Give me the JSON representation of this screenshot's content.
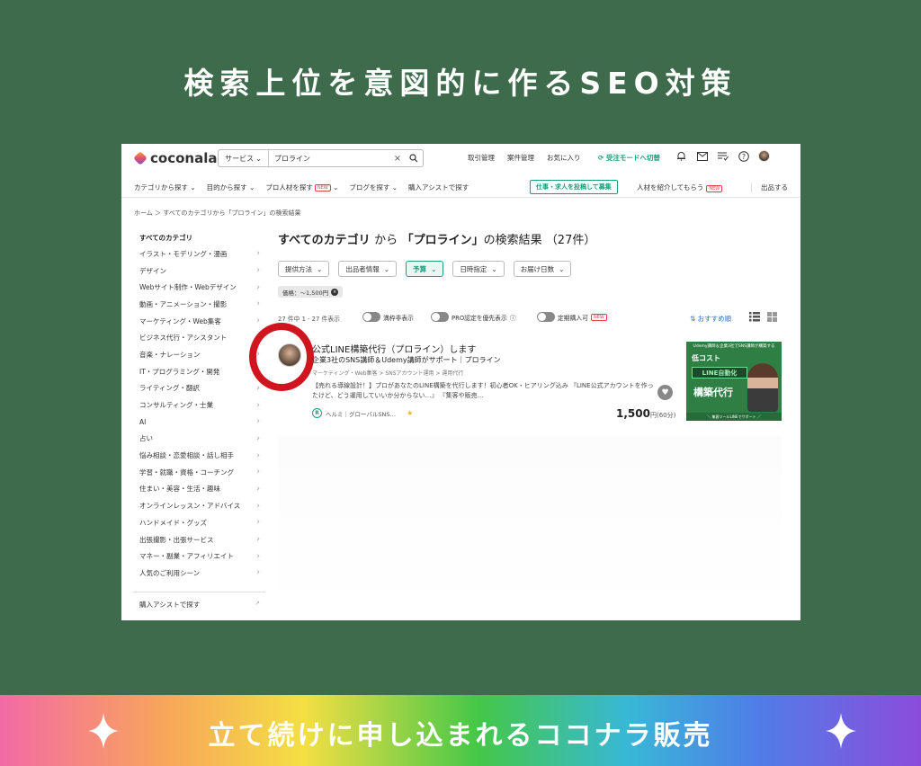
{
  "page_title": "検索上位を意図的に作るSEO対策",
  "banner_text": "立て続けに申し込まれるココナラ販売",
  "header": {
    "logo": "coconala",
    "search_category": "サービス",
    "search_value": "プロライン",
    "links": [
      "取引管理",
      "案件管理",
      "お気に入り"
    ],
    "mode_switch": "受注モードへ切替"
  },
  "nav": {
    "items": [
      "カテゴリから探す",
      "目的から探す",
      "プロ人材を探す",
      "ブログを探す",
      "購入アシストで探す"
    ],
    "new_label": "NEW",
    "post_job": "仕事・求人を投稿して募集",
    "refer": "人材を紹介してもらう",
    "sell": "出品する"
  },
  "breadcrumb": "ホーム ＞ すべてのカテゴリから「プロライン」の検索結果",
  "sidebar": {
    "heading": "すべてのカテゴリ",
    "items": [
      "イラスト・モデリング・漫画",
      "デザイン",
      "Webサイト制作・Webデザイン",
      "動画・アニメーション・撮影",
      "マーケティング・Web集客",
      "ビジネス代行・アシスタント",
      "音楽・ナレーション",
      "IT・プログラミング・開発",
      "ライティング・翻訳",
      "コンサルティング・士業",
      "AI",
      "占い",
      "悩み相談・恋愛相談・話し相手",
      "学習・就職・資格・コーチング",
      "住まい・美容・生活・趣味",
      "オンラインレッスン・アドバイス",
      "ハンドメイド・グッズ",
      "出張撮影・出張サービス",
      "マネー・副業・アフィリエイト",
      "人気のご利用シーン"
    ],
    "bottom": "購入アシストで探す"
  },
  "results": {
    "title_bold1": "すべてのカテゴリ",
    "title_from": "から",
    "title_bold2": "「プロライン」",
    "title_rest": "の検索結果 （27件）",
    "filters": [
      "提供方法",
      "出品者情報",
      "予算",
      "日時指定",
      "お届け日数"
    ],
    "chip": "価格：〜1,500円",
    "count": "27 件中 1 - 27 件表示",
    "toggles": [
      "満枠非表示",
      "PRO認定を優先表示",
      "定期購入可"
    ],
    "toggle_new": "NEW",
    "sort": "おすすめ順"
  },
  "card": {
    "title": "公式LINE構築代行（プロライン）します",
    "subtitle": "企業3社のSNS講師＆Udemy講師がサポート｜プロライン",
    "category": "マーケティング・Web集客 > SNSアカウント運用 > 運用代行",
    "description": "【売れる導線設計！】プロがあなたのLINE構築を代行します！初心者OK・ヒアリング込み 『LINE公式アカウントを作ったけど、どう運用していいか分からない…』 『集客や販売...",
    "seller": "ヘルミ｜グローバルSNS…",
    "rank_badge": "R",
    "price": "1,500",
    "price_unit": "円(60分)",
    "thumb_top": "Udemy講師＆企業3社でSNS講師が構築する",
    "thumb_lowcost": "低コスト",
    "thumb_line": "LINE自動化",
    "thumb_main": "構築代行",
    "thumb_bottom": "＼ 集客ツールLINEでサポート ／"
  },
  "colors": {
    "background": "#3e6b4b",
    "accent": "#1a9e7c",
    "highlight_circle": "#d0151f"
  }
}
